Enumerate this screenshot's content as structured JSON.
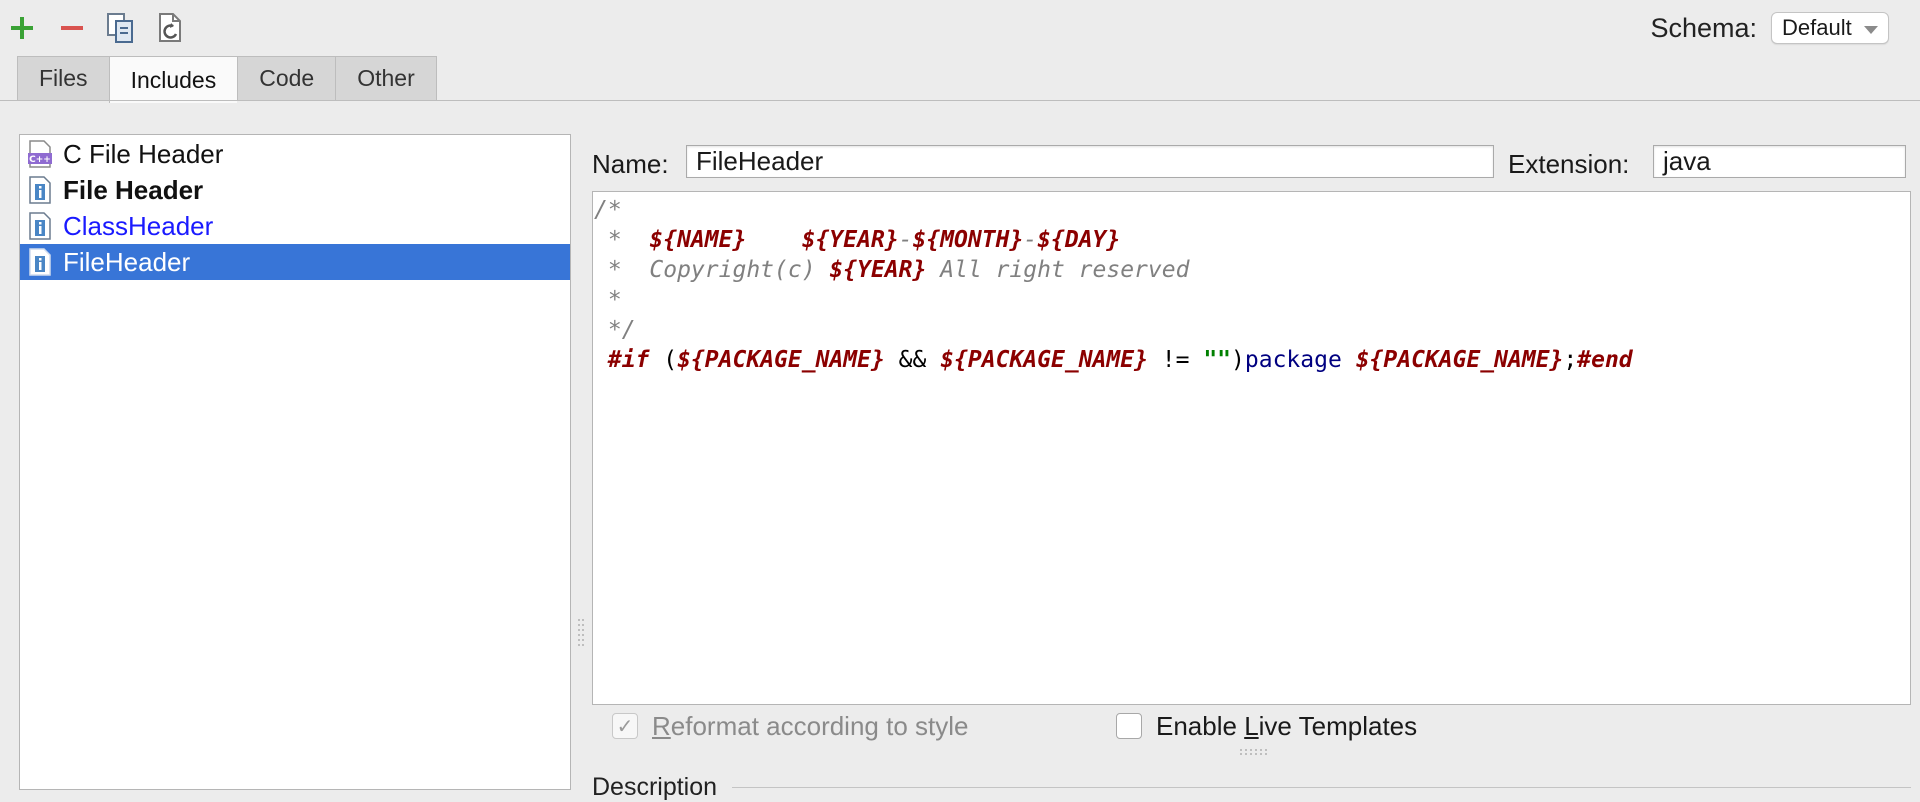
{
  "toolbar": {
    "add_icon": "plus-icon",
    "remove_icon": "minus-icon",
    "copy_icon": "copy-icon",
    "reset_icon": "reset-to-default-icon",
    "schema_label": "Schema:",
    "schema_value": "Default"
  },
  "tabs": [
    {
      "label": "Files",
      "active": false
    },
    {
      "label": "Includes",
      "active": true
    },
    {
      "label": "Code",
      "active": false
    },
    {
      "label": "Other",
      "active": false
    }
  ],
  "templates": [
    {
      "label": "C File Header",
      "icon": "cpp-file-icon",
      "style": "normal"
    },
    {
      "label": "File Header",
      "icon": "java-file-icon",
      "style": "bold"
    },
    {
      "label": "ClassHeader",
      "icon": "java-file-icon",
      "style": "modified"
    },
    {
      "label": "FileHeader",
      "icon": "java-file-icon",
      "style": "selected"
    }
  ],
  "editor": {
    "name_label": "Name:",
    "name_value": "FileHeader",
    "extension_label": "Extension:",
    "extension_value": "java",
    "code_lines": [
      "/*",
      " *  ${NAME}    ${YEAR}-${MONTH}-${DAY}",
      " *  Copyright(c) ${YEAR} All right reserved",
      " *",
      " */",
      "#if (${PACKAGE_NAME} && ${PACKAGE_NAME} != \"\")package ${PACKAGE_NAME};#end"
    ],
    "colors": {
      "comment": "#808080",
      "variable": "#8b0000",
      "keyword": "#000080",
      "string": "#008000"
    }
  },
  "options": {
    "reformat_pre": "R",
    "reformat_post": "eformat according to style",
    "reformat_checked": true,
    "reformat_enabled": false,
    "live_pre": "Enable ",
    "live_mn": "L",
    "live_post": "ive Templates",
    "live_checked": false
  },
  "description_label": "Description",
  "accent_color": "#3875d7"
}
